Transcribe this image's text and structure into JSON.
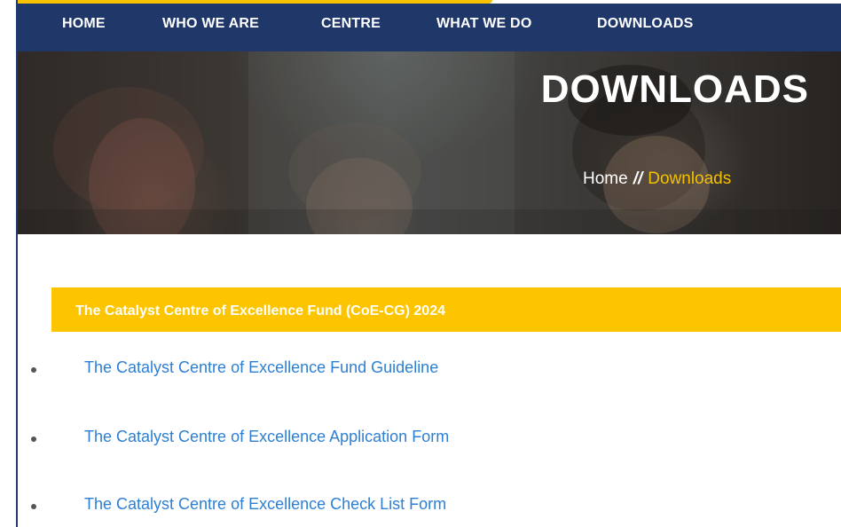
{
  "nav": {
    "items": [
      "HOME",
      "WHO WE ARE",
      "CENTRE",
      "WHAT WE DO",
      "DOWNLOADS"
    ]
  },
  "hero": {
    "title": "DOWNLOADS",
    "breadcrumb": {
      "home": "Home",
      "separator": "//",
      "current": "Downloads"
    }
  },
  "section": {
    "title": "The Catalyst Centre of Excellence Fund (CoE-CG) 2024",
    "links": [
      "The Catalyst Centre of Excellence Fund Guideline",
      "The Catalyst Centre of Excellence Application Form",
      "The Catalyst Centre of Excellence Check List Form"
    ]
  },
  "colors": {
    "nav_background": "#1f3769",
    "accent_yellow": "#fcc500",
    "breadcrumb_current": "#f5c000",
    "link_blue": "#2d7fd4"
  }
}
